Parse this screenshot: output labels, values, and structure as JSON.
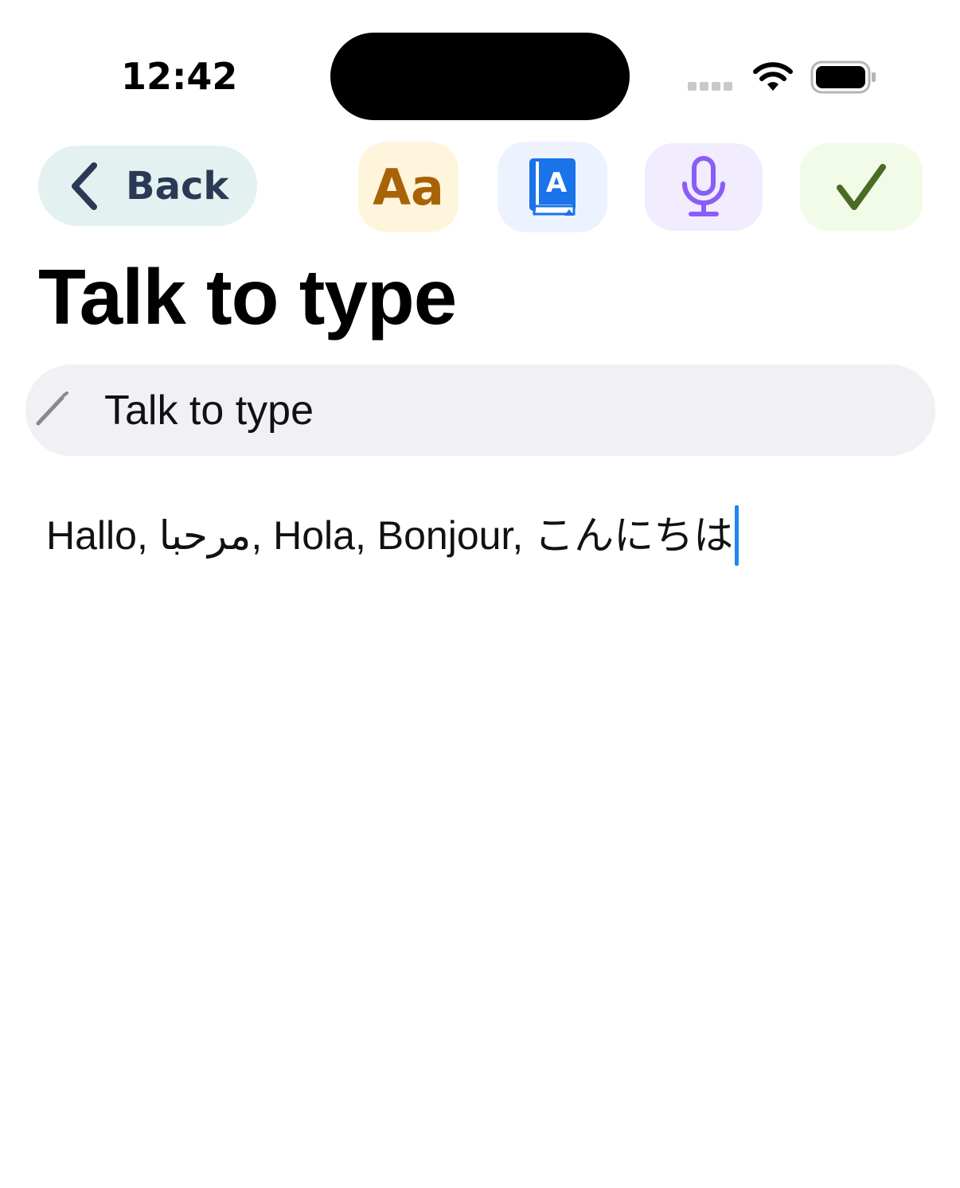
{
  "status_bar": {
    "time": "12:42"
  },
  "toolbar": {
    "back_label": "Back",
    "font_button_label": "Aa",
    "dictionary_button_glyph": "A",
    "icons": [
      "chevron-left-icon",
      "dictionary-icon",
      "microphone-icon",
      "checkmark-icon"
    ]
  },
  "page": {
    "title": "Talk to type"
  },
  "title_field": {
    "value": "Talk to type"
  },
  "editor": {
    "text": "Hallo, مرحبا, Hola, Bonjour, こんにちは"
  },
  "colors": {
    "back_button_bg": "#e3f1f1",
    "back_text": "#2b3a54",
    "font_button_bg": "#fff5dd",
    "font_button_fg": "#a86306",
    "dictionary_button_bg": "#ecf2fe",
    "dictionary_icon": "#1a73e8",
    "mic_button_bg": "#f1ecfe",
    "mic_icon": "#8b5cf6",
    "done_button_bg": "#f2fbe8",
    "done_icon": "#4a6b24",
    "caret": "#1e88f0",
    "field_bg": "#f1f1f5"
  }
}
